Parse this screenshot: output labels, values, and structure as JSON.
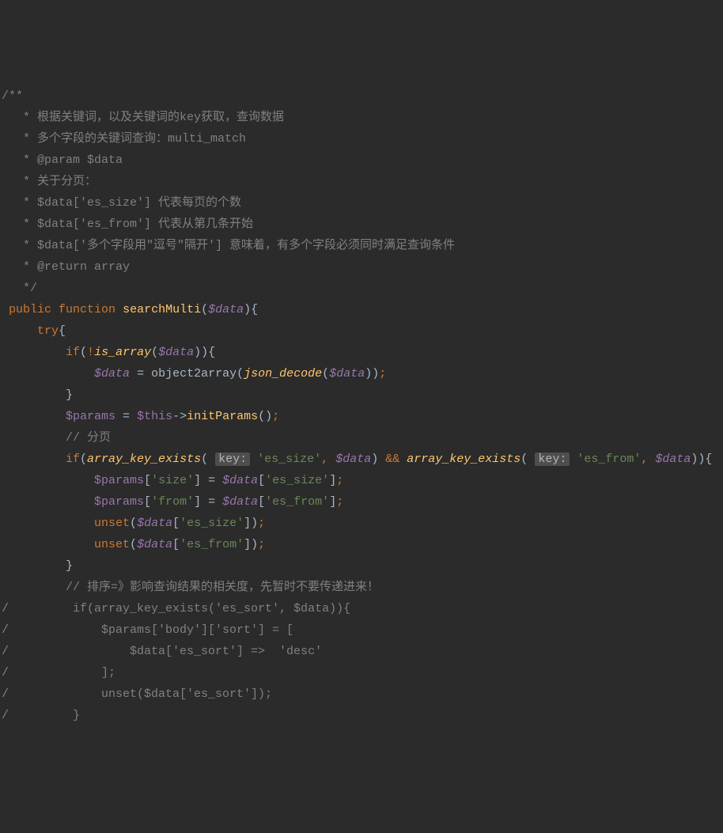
{
  "code": {
    "docblock": {
      "open": "/**",
      "l1": " * 根据关键词，以及关键词的key获取，查询数据",
      "l2": " * 多个字段的关键词查询：multi_match",
      "l3": " * @param $data",
      "l4": " * 关于分页：",
      "l5": " * $data['es_size'] 代表每页的个数",
      "l6": " * $data['es_from'] 代表从第几条开始",
      "l7": " * $data['多个字段用\"逗号\"隔开'] 意味着，有多个字段必须同时满足查询条件",
      "l8": " * @return array",
      "close": " */"
    },
    "func": {
      "public": "public",
      "function": "function",
      "name": "searchMulti",
      "param": "$data",
      "openBrace": "{",
      "try": "try",
      "try_brace": "{",
      "if": "if",
      "not": "!",
      "is_array": "is_array",
      "var_data": "$data",
      "obj2arr": "object2array",
      "json_decode": "json_decode",
      "assign": "=",
      "semi": ";",
      "close_brace": "}",
      "var_params": "$params",
      "var_this": "$this",
      "arrow": "->",
      "initParams": "initParams",
      "comment_page": "// 分页",
      "ake": "array_key_exists",
      "hint_key": "key:",
      "str_es_size": "'es_size'",
      "str_es_from": "'es_from'",
      "and": "&&",
      "str_size": "'size'",
      "str_from": "'from'",
      "unset": "unset",
      "comment_sort": "// 排序=》影响查询结果的相关度，先暂时不要传递进来！",
      "c1": "/         if(array_key_exists('es_sort', $data)){",
      "c2": "/             $params['body']['sort'] = [",
      "c3": "/                 $data['es_sort'] =>  'desc'",
      "c4": "/             ];",
      "c5": "/             unset($data['es_sort']);",
      "c6": "/         }"
    }
  }
}
